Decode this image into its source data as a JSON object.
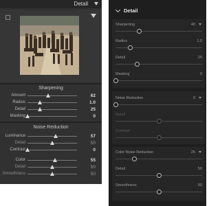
{
  "left": {
    "header_title": "Detail",
    "sharpening_title": "Sharpening",
    "sharpening": [
      {
        "label": "Amount",
        "value": "62",
        "pct": 0.41,
        "dim": false
      },
      {
        "label": "Radius",
        "value": "1.0",
        "pct": 0.25,
        "dim": false
      },
      {
        "label": "Detail",
        "value": "25",
        "pct": 0.25,
        "dim": false
      },
      {
        "label": "Masking",
        "value": "0",
        "pct": 0.0,
        "dim": false
      }
    ],
    "noise_title": "Noise Reduction",
    "noise": [
      {
        "label": "Luminance",
        "value": "57",
        "pct": 0.57,
        "dim": false
      },
      {
        "label": "Detail",
        "value": "50",
        "pct": 0.5,
        "dim": true
      },
      {
        "label": "Contrast",
        "value": "0",
        "pct": 0.0,
        "dim": false
      },
      {
        "label": "Color",
        "value": "55",
        "pct": 0.55,
        "dim": false
      },
      {
        "label": "Detail",
        "value": "50",
        "pct": 0.5,
        "dim": true
      },
      {
        "label": "Smoothness",
        "value": "50",
        "pct": 0.5,
        "dim": true
      }
    ]
  },
  "right": {
    "title": "Detail",
    "sharpening": [
      {
        "label": "Sharpening",
        "value": "40",
        "pct": 0.27,
        "dim": false,
        "caret": true
      },
      {
        "label": "Radius",
        "value": "1.0",
        "pct": 0.17,
        "dim": false
      },
      {
        "label": "Detail",
        "value": "25",
        "pct": 0.25,
        "dim": false
      },
      {
        "label": "Masking",
        "value": "0",
        "pct": 0.0,
        "dim": false
      }
    ],
    "noise": {
      "title": "Noise Reduction",
      "value": "0",
      "rows": [
        {
          "label": "Detail",
          "value": "",
          "pct": 0.5,
          "dim": true
        },
        {
          "label": "Contrast",
          "value": "",
          "pct": 0.5,
          "dim": true
        }
      ]
    },
    "color_noise": {
      "title": "Color Noise Reduction",
      "value": "25",
      "rows": [
        {
          "label": "Detail",
          "value": "50",
          "pct": 0.5,
          "dim": false
        },
        {
          "label": "Smoothness",
          "value": "50",
          "pct": 0.5,
          "dim": false
        }
      ]
    }
  }
}
